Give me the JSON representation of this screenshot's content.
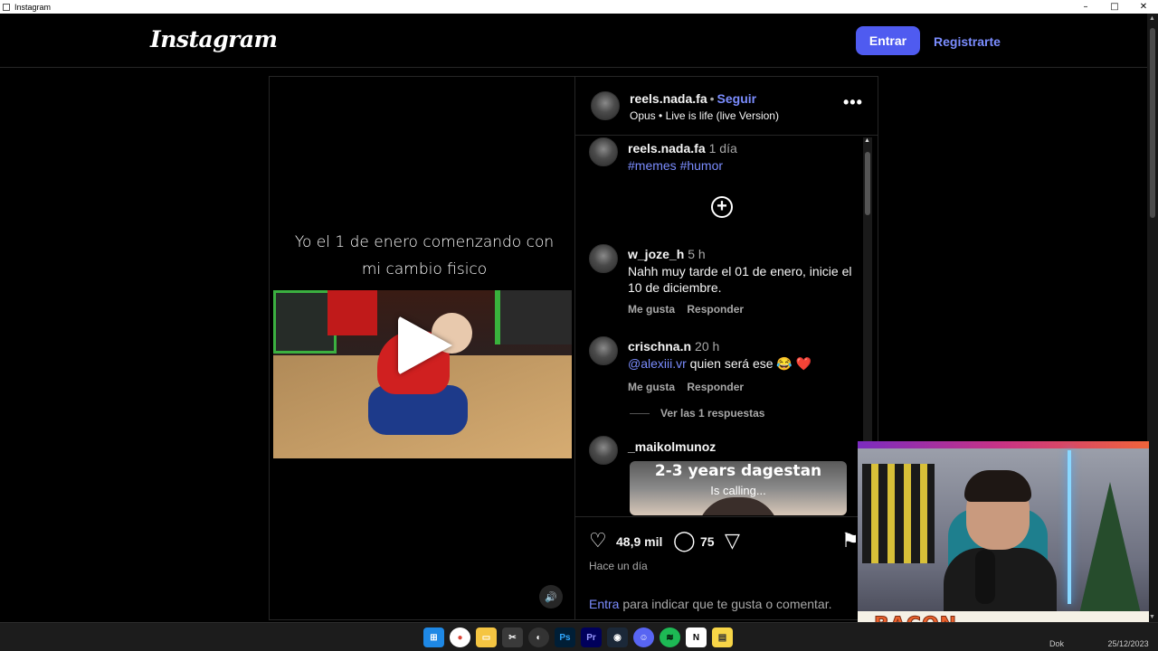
{
  "window": {
    "title": "Instagram",
    "controls": [
      "–",
      "□",
      "✕"
    ]
  },
  "header": {
    "logo": "Instagram",
    "login_button": "Entrar",
    "signup_link": "Registrarte"
  },
  "post": {
    "caption_overlay_line1": "Yo el 1 de enero comenzando con",
    "caption_overlay_line2": "mi cambio fisico",
    "author": "reels.nada.fa",
    "follow_label": "Seguir",
    "audio_artist": "Opus",
    "audio_track": "Live is life (live Version)",
    "description": {
      "user": "reels.nada.fa",
      "time": "1 día",
      "hashtags": "#memes #humor"
    },
    "comments": [
      {
        "user": "w_joze_h",
        "time": "5 h",
        "text": "Nahh muy tarde el 01 de enero, inicie el 10 de diciembre.",
        "like": "Me gusta",
        "reply": "Responder"
      },
      {
        "user": "crischna.n",
        "time": "20 h",
        "mention": "@alexiii.vr",
        "text": " quien será ese 😂 ❤️",
        "like": "Me gusta",
        "reply": "Responder"
      },
      {
        "user": "_maikolmunoz",
        "time": ""
      }
    ],
    "view_replies": "Ver las 1 respuestas",
    "meme": {
      "line1": "2-3 years dagestan",
      "line2": "Is calling..."
    },
    "likes": "48,9 mil",
    "comments_count": "75",
    "posted_ago": "Hace un día",
    "login_prompt_link": "Entra",
    "login_prompt_text": " para indicar que te gusta o comentar."
  },
  "webcam": {
    "label": "BACON"
  },
  "taskbar": {
    "clock_time": "Dok",
    "clock_date": "25/12/2023"
  }
}
